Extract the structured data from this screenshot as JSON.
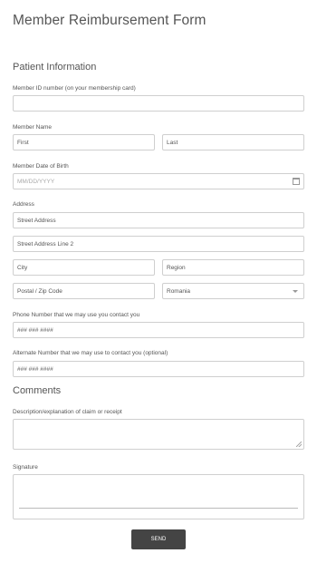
{
  "form": {
    "title": "Member Reimbursement Form",
    "send_label": "SEND"
  },
  "patient_section": {
    "heading": "Patient Information",
    "member_id": {
      "label": "Member ID number (on your membership card)",
      "value": ""
    },
    "member_name": {
      "label": "Member Name",
      "first_placeholder": "First",
      "last_placeholder": "Last"
    },
    "dob": {
      "label": "Member Date of Birth",
      "placeholder": "MM/DD/YYYY",
      "icon": "calendar-icon"
    },
    "address": {
      "label": "Address",
      "street_placeholder": "Street Address",
      "street2_placeholder": "Street Address Line 2",
      "city_placeholder": "City",
      "region_placeholder": "Region",
      "postal_placeholder": "Postal / Zip Code",
      "country_value": "Romania"
    },
    "phone": {
      "label": "Phone Number that we may use you contact you",
      "placeholder": "### ### ####"
    },
    "alt_phone": {
      "label": "Alternate Number that we may use to contact you (optional)",
      "placeholder": "### ### ####"
    }
  },
  "comments_section": {
    "heading": "Comments",
    "description": {
      "label": "Description/explanation of claim or receipt",
      "value": ""
    },
    "signature": {
      "label": "Signature"
    }
  }
}
